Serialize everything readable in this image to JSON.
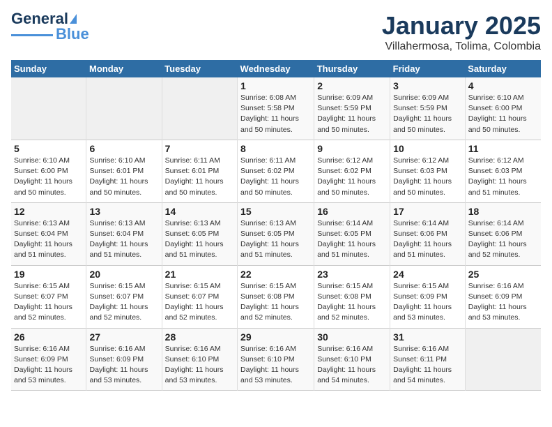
{
  "header": {
    "logo_main": "General",
    "logo_sub": "Blue",
    "title": "January 2025",
    "subtitle": "Villahermosa, Tolima, Colombia"
  },
  "weekdays": [
    "Sunday",
    "Monday",
    "Tuesday",
    "Wednesday",
    "Thursday",
    "Friday",
    "Saturday"
  ],
  "weeks": [
    [
      {
        "day": "",
        "info": ""
      },
      {
        "day": "",
        "info": ""
      },
      {
        "day": "",
        "info": ""
      },
      {
        "day": "1",
        "info": "Sunrise: 6:08 AM\nSunset: 5:58 PM\nDaylight: 11 hours and 50 minutes."
      },
      {
        "day": "2",
        "info": "Sunrise: 6:09 AM\nSunset: 5:59 PM\nDaylight: 11 hours and 50 minutes."
      },
      {
        "day": "3",
        "info": "Sunrise: 6:09 AM\nSunset: 5:59 PM\nDaylight: 11 hours and 50 minutes."
      },
      {
        "day": "4",
        "info": "Sunrise: 6:10 AM\nSunset: 6:00 PM\nDaylight: 11 hours and 50 minutes."
      }
    ],
    [
      {
        "day": "5",
        "info": "Sunrise: 6:10 AM\nSunset: 6:00 PM\nDaylight: 11 hours and 50 minutes."
      },
      {
        "day": "6",
        "info": "Sunrise: 6:10 AM\nSunset: 6:01 PM\nDaylight: 11 hours and 50 minutes."
      },
      {
        "day": "7",
        "info": "Sunrise: 6:11 AM\nSunset: 6:01 PM\nDaylight: 11 hours and 50 minutes."
      },
      {
        "day": "8",
        "info": "Sunrise: 6:11 AM\nSunset: 6:02 PM\nDaylight: 11 hours and 50 minutes."
      },
      {
        "day": "9",
        "info": "Sunrise: 6:12 AM\nSunset: 6:02 PM\nDaylight: 11 hours and 50 minutes."
      },
      {
        "day": "10",
        "info": "Sunrise: 6:12 AM\nSunset: 6:03 PM\nDaylight: 11 hours and 50 minutes."
      },
      {
        "day": "11",
        "info": "Sunrise: 6:12 AM\nSunset: 6:03 PM\nDaylight: 11 hours and 51 minutes."
      }
    ],
    [
      {
        "day": "12",
        "info": "Sunrise: 6:13 AM\nSunset: 6:04 PM\nDaylight: 11 hours and 51 minutes."
      },
      {
        "day": "13",
        "info": "Sunrise: 6:13 AM\nSunset: 6:04 PM\nDaylight: 11 hours and 51 minutes."
      },
      {
        "day": "14",
        "info": "Sunrise: 6:13 AM\nSunset: 6:05 PM\nDaylight: 11 hours and 51 minutes."
      },
      {
        "day": "15",
        "info": "Sunrise: 6:13 AM\nSunset: 6:05 PM\nDaylight: 11 hours and 51 minutes."
      },
      {
        "day": "16",
        "info": "Sunrise: 6:14 AM\nSunset: 6:05 PM\nDaylight: 11 hours and 51 minutes."
      },
      {
        "day": "17",
        "info": "Sunrise: 6:14 AM\nSunset: 6:06 PM\nDaylight: 11 hours and 51 minutes."
      },
      {
        "day": "18",
        "info": "Sunrise: 6:14 AM\nSunset: 6:06 PM\nDaylight: 11 hours and 52 minutes."
      }
    ],
    [
      {
        "day": "19",
        "info": "Sunrise: 6:15 AM\nSunset: 6:07 PM\nDaylight: 11 hours and 52 minutes."
      },
      {
        "day": "20",
        "info": "Sunrise: 6:15 AM\nSunset: 6:07 PM\nDaylight: 11 hours and 52 minutes."
      },
      {
        "day": "21",
        "info": "Sunrise: 6:15 AM\nSunset: 6:07 PM\nDaylight: 11 hours and 52 minutes."
      },
      {
        "day": "22",
        "info": "Sunrise: 6:15 AM\nSunset: 6:08 PM\nDaylight: 11 hours and 52 minutes."
      },
      {
        "day": "23",
        "info": "Sunrise: 6:15 AM\nSunset: 6:08 PM\nDaylight: 11 hours and 52 minutes."
      },
      {
        "day": "24",
        "info": "Sunrise: 6:15 AM\nSunset: 6:09 PM\nDaylight: 11 hours and 53 minutes."
      },
      {
        "day": "25",
        "info": "Sunrise: 6:16 AM\nSunset: 6:09 PM\nDaylight: 11 hours and 53 minutes."
      }
    ],
    [
      {
        "day": "26",
        "info": "Sunrise: 6:16 AM\nSunset: 6:09 PM\nDaylight: 11 hours and 53 minutes."
      },
      {
        "day": "27",
        "info": "Sunrise: 6:16 AM\nSunset: 6:09 PM\nDaylight: 11 hours and 53 minutes."
      },
      {
        "day": "28",
        "info": "Sunrise: 6:16 AM\nSunset: 6:10 PM\nDaylight: 11 hours and 53 minutes."
      },
      {
        "day": "29",
        "info": "Sunrise: 6:16 AM\nSunset: 6:10 PM\nDaylight: 11 hours and 53 minutes."
      },
      {
        "day": "30",
        "info": "Sunrise: 6:16 AM\nSunset: 6:10 PM\nDaylight: 11 hours and 54 minutes."
      },
      {
        "day": "31",
        "info": "Sunrise: 6:16 AM\nSunset: 6:11 PM\nDaylight: 11 hours and 54 minutes."
      },
      {
        "day": "",
        "info": ""
      }
    ]
  ]
}
